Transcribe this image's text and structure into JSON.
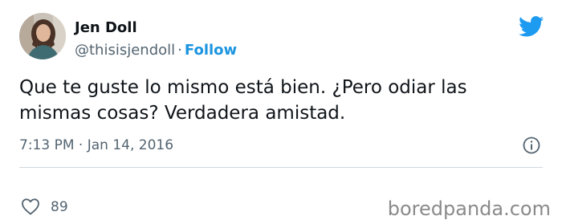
{
  "author": {
    "name": "Jen Doll",
    "handle": "@thisisjendoll",
    "separator": "·",
    "follow_label": "Follow"
  },
  "tweet": {
    "text": "Que te guste lo mismo está bien. ¿Pero odiar las mismas cosas? Verdadera amistad.",
    "timestamp": "7:13 PM · Jan 14, 2016",
    "likes": "89"
  },
  "icons": {
    "brand": "twitter-bird-icon",
    "info": "info-icon",
    "like": "heart-icon"
  },
  "colors": {
    "brand_blue": "#1d9bf0",
    "follow_blue": "#1b95e0",
    "secondary_text": "#536471",
    "divider": "#cfd9de"
  },
  "watermark": {
    "text": "boredpanda.com"
  }
}
